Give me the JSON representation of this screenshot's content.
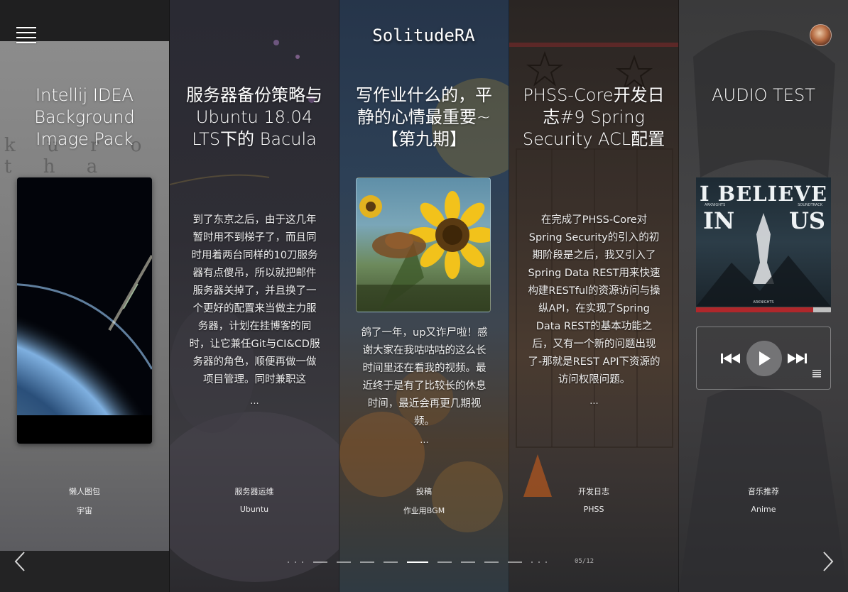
{
  "header": {
    "site_title": "SolitudeRA"
  },
  "posts": [
    {
      "title": "Intellij IDEA Background Image Pack",
      "description": "",
      "category": "懒人图包",
      "tag": "宇宙",
      "decor_text": "k u   r o t h   a"
    },
    {
      "title": "服务器备份策略与Ubuntu 18.04 LTS下的 Bacula",
      "description": "到了东京之后，由于这几年暂时用不到梯子了，而且同时用着两台同样的10刀服务器有点傻吊，所以就把邮件服务器关掉了，并且换了一个更好的配置来当做主力服务器，计划在挂博客的同时，让它兼任Git与CI&CD服务器的角色，顺便再做一做项目管理。同时兼职这",
      "ellipsis": "...",
      "category": "服务器运维",
      "tag": "Ubuntu"
    },
    {
      "title": "写作业什么的，平静的心情最重要~【第九期】",
      "description": "鸽了一年，up又诈尸啦！感谢大家在我咕咕咕的这么长时间里还在看我的视频。最近终于是有了比较长的休息时间，最近会再更几期视频。",
      "ellipsis": "...",
      "category": "投稿",
      "tag": "作业用BGM"
    },
    {
      "title": "PHSS-Core开发日志#9 Spring Security ACL配置",
      "description": "在完成了PHSS-Core对Spring Security的引入的初期阶段是之后，我又引入了Spring Data REST用来快速构建RESTful的资源访问与操纵API，在实现了Spring Data REST的基本功能之后，又有一个新的问题出现了-那就是REST API下资源的访问权限问题。",
      "ellipsis": "...",
      "category": "开发日志",
      "tag": "PHSS"
    },
    {
      "title": "AUDIO TEST",
      "description": "",
      "category": "音乐推荐",
      "tag": "Anime",
      "album": {
        "line1": "I BELIEVE",
        "line2_left": "IN",
        "line2_right": "US",
        "small_left": "ARKNIGHTS",
        "small_right": "SOUNDTRACK",
        "label": "ARKNIGHTS"
      },
      "player": {
        "progress": 0.87,
        "progress_color": "#b0272b"
      }
    }
  ],
  "pagination": {
    "current": 5,
    "total": 12,
    "label": "05/12"
  },
  "icons": {
    "menu": "hamburger-menu-icon",
    "prev": "chevron-left-icon",
    "next": "chevron-right-icon",
    "rewind": "skip-back-icon",
    "play": "play-icon",
    "forward": "skip-forward-icon",
    "playlist": "playlist-icon"
  }
}
